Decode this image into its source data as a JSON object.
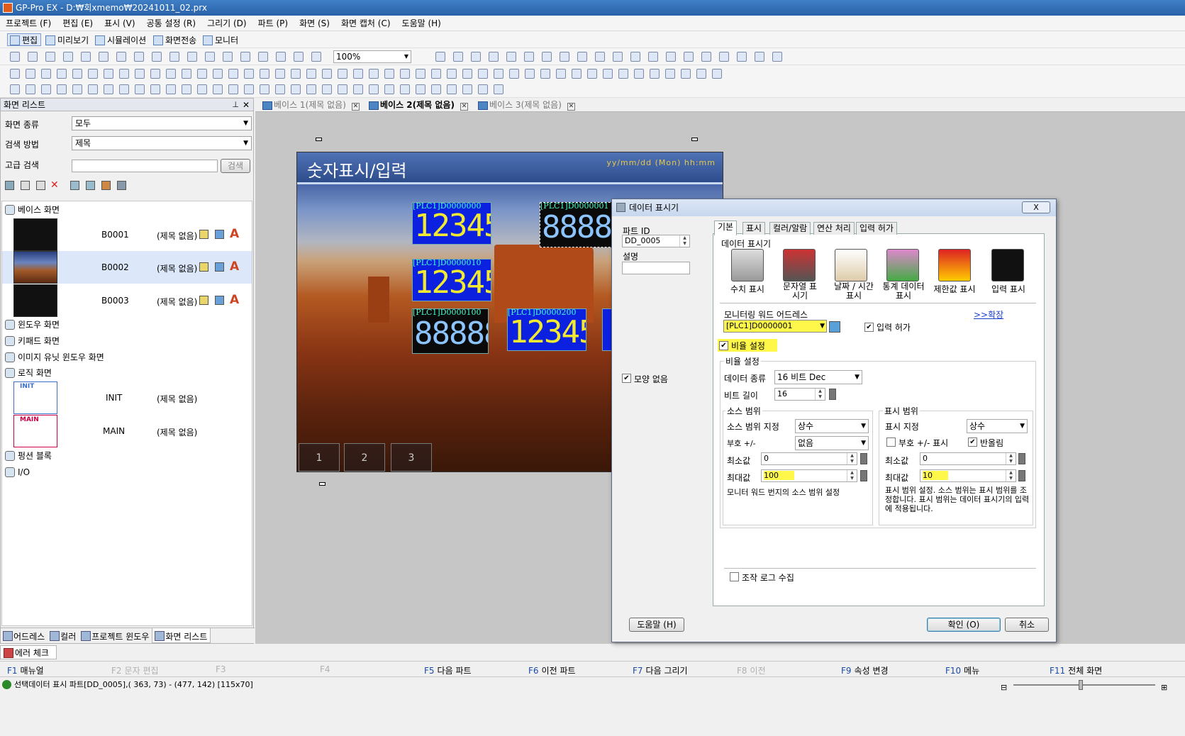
{
  "window": {
    "title": "GP-Pro EX - D:₩회xmemo₩20241011_02.prx"
  },
  "menu": [
    "프로젝트 (F)",
    "편집 (E)",
    "표시 (V)",
    "공통 설정 (R)",
    "그리기 (D)",
    "파트 (P)",
    "화면 (S)",
    "화면 캡처 (C)",
    "도움말 (H)"
  ],
  "modes": {
    "edit": "편집",
    "preview": "미리보기",
    "simulation": "시뮬레이션",
    "transfer": "화면전송",
    "monitor": "모니터"
  },
  "toolbar": {
    "zoom": "100%"
  },
  "screen_list": {
    "title": "화면 리스트",
    "screen_type_label": "화면 종류",
    "screen_type_value": "모두",
    "search_method_label": "검색 방법",
    "search_method_value": "제목",
    "adv_search_label": "고급 검색",
    "search_button": "검색",
    "tree": {
      "base": "베이스 화면",
      "window": "윈도우 화면",
      "keypad": "키패드 화면",
      "image_unit": "이미지 유닛 윈도우 화면",
      "logic": "로직 화면",
      "function": "펑션 블록",
      "io": "I/O",
      "base_items": [
        {
          "id": "B0001",
          "title": "(제목 없음)"
        },
        {
          "id": "B0002",
          "title": "(제목 없음)"
        },
        {
          "id": "B0003",
          "title": "(제목 없음)"
        }
      ],
      "logic_items": [
        {
          "id": "INIT",
          "thumb": "INIT",
          "title": "(제목 없음)"
        },
        {
          "id": "MAIN",
          "thumb": "MAIN",
          "title": "(제목 없음)"
        }
      ]
    },
    "bottom_tabs": [
      "어드레스",
      "컬러",
      "프로젝트 윈도우",
      "화면 리스트"
    ]
  },
  "editor_tabs": [
    {
      "label": "베이스 1(제목 없음)",
      "active": false
    },
    {
      "label": "베이스 2(제목 없음)",
      "active": true
    },
    {
      "label": "베이스 3(제목 없음)",
      "active": false
    }
  ],
  "screen": {
    "title": "숫자표시/입력",
    "datetime": "yy/mm/dd (Mon) hh:mm",
    "displays": [
      {
        "addr": "[PLC1]D0000000",
        "value": "12345"
      },
      {
        "addr": "[PLC1]D0000001",
        "value": "88888"
      },
      {
        "addr": "[PLC1]D0000010",
        "value": "12345"
      },
      {
        "addr": "[PLC1]D0000100",
        "value": "88888"
      },
      {
        "addr": "[PLC1]D0000200",
        "value": "12345"
      }
    ],
    "buttons": [
      "1",
      "2",
      "3"
    ]
  },
  "dialog": {
    "title": "데이터 표시기",
    "close": "X",
    "part_id_label": "파트 ID",
    "part_id": "DD_0005",
    "desc_label": "설명",
    "no_shape": "모양 없음",
    "tabs": [
      "기본",
      "표시",
      "컬러/알람",
      "연산 처리",
      "입력 허가"
    ],
    "section": "데이터 표시기",
    "types": [
      {
        "label": "수치 표시"
      },
      {
        "label": "문자열 표시기"
      },
      {
        "label": "날짜 / 시간 표시"
      },
      {
        "label": "통계 데이터 표시"
      },
      {
        "label": "제한값 표시"
      },
      {
        "label": "입력 표시"
      }
    ],
    "monitor_word_label": "모니터링 워드 어드레스",
    "expand": ">>확장",
    "monitor_word": "[PLC1]D0000001",
    "input_permit": "입력 허가",
    "scaling_enable": "비율 설정",
    "scaling_group": "비율 설정",
    "data_type_label": "데이터 종류",
    "data_type": "16 비트 Dec",
    "bit_length_label": "비트 길이",
    "bit_length": "16",
    "source": {
      "group": "소스 범위",
      "spec_label": "소스 범위 지정",
      "spec": "상수",
      "sign_label": "부호 +/-",
      "sign": "없음",
      "min_label": "최소값",
      "min": "0",
      "max_label": "최대값",
      "max": "100",
      "note": "모니터 워드 번지의 소스 범위 설정"
    },
    "display": {
      "group": "표시 범위",
      "spec_label": "표시 지정",
      "spec": "상수",
      "sign_label": "부호 +/- 표시",
      "round_label": "반올림",
      "min_label": "최소값",
      "min": "0",
      "max_label": "최대값",
      "max": "10",
      "note": "표시 범위 설정. 소스 범위는 표시 범위를 조정합니다. 표시 범위는 데이터 표시기의 입력에 적용됩니다."
    },
    "op_log": "조작 로그 수집",
    "help": "도움말 (H)",
    "ok": "확인 (O)",
    "cancel": "취소"
  },
  "error_check": "에러 체크",
  "fkeys": [
    {
      "k": "F1",
      "l": "매뉴얼",
      "en": true
    },
    {
      "k": "F2",
      "l": "문자 편집",
      "en": false
    },
    {
      "k": "F3",
      "l": "",
      "en": false
    },
    {
      "k": "F4",
      "l": "",
      "en": false
    },
    {
      "k": "F5",
      "l": "다음 파트",
      "en": true
    },
    {
      "k": "F6",
      "l": "이전 파트",
      "en": true
    },
    {
      "k": "F7",
      "l": "다음 그리기",
      "en": true
    },
    {
      "k": "F8",
      "l": "이전",
      "en": false
    },
    {
      "k": "F9",
      "l": "속성 변경",
      "en": true
    },
    {
      "k": "F10",
      "l": "메뉴",
      "en": true
    },
    {
      "k": "F11",
      "l": "전체 화면",
      "en": true
    }
  ],
  "status": "선택데이터 표시 파트[DD_0005],( 363,  73) - (477, 142) [115x70]",
  "colors": {
    "highlight": "#fff84a",
    "num_bg": "#0c20e0",
    "num_fg": "#f2ea30",
    "titlebar": "#2a62a8"
  }
}
